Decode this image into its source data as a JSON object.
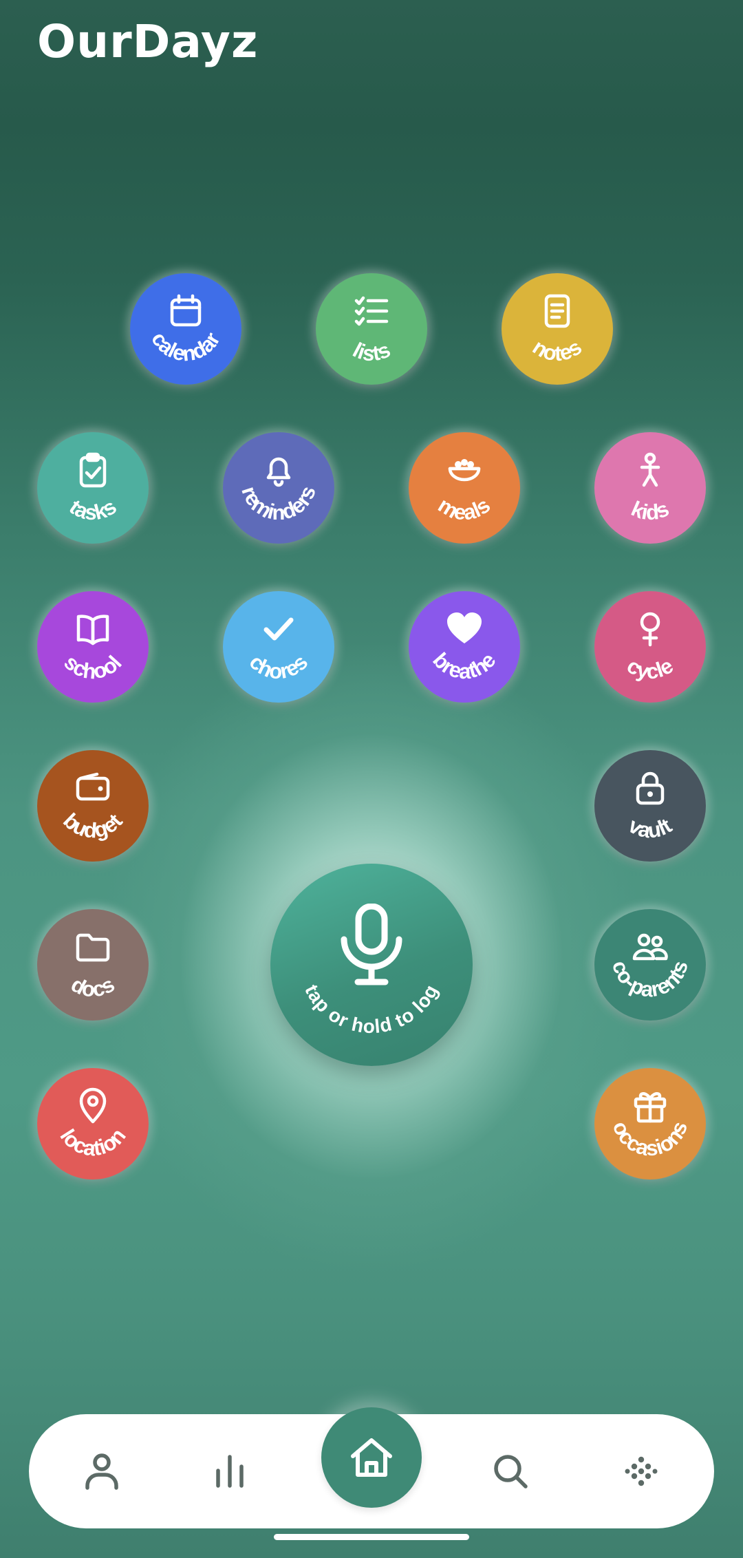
{
  "app": {
    "title": "OurDayz"
  },
  "modules": [
    {
      "id": "calendar",
      "label": "calendar",
      "color": "#3f6ee8",
      "icon": "calendar-icon"
    },
    {
      "id": "lists",
      "label": "lists",
      "color": "#5fb776",
      "icon": "checklist-icon"
    },
    {
      "id": "notes",
      "label": "notes",
      "color": "#dbb43a",
      "icon": "note-icon"
    },
    {
      "id": "tasks",
      "label": "tasks",
      "color": "#4eaf9f",
      "icon": "clipboard-check-icon"
    },
    {
      "id": "reminders",
      "label": "reminders",
      "color": "#5e6bb9",
      "icon": "bell-icon"
    },
    {
      "id": "meals",
      "label": "meals",
      "color": "#e58040",
      "icon": "bowl-icon"
    },
    {
      "id": "kids",
      "label": "kids",
      "color": "#de77ae",
      "icon": "child-icon"
    },
    {
      "id": "school",
      "label": "school",
      "color": "#a748dc",
      "icon": "book-icon"
    },
    {
      "id": "chores",
      "label": "chores",
      "color": "#58b4ea",
      "icon": "check-icon"
    },
    {
      "id": "breathe",
      "label": "breathe",
      "color": "#8a58eb",
      "icon": "heart-icon"
    },
    {
      "id": "cycle",
      "label": "cycle",
      "color": "#d55a86",
      "icon": "female-icon"
    },
    {
      "id": "budget",
      "label": "budget",
      "color": "#a6541f",
      "icon": "wallet-icon"
    },
    {
      "id": "vault",
      "label": "vault",
      "color": "#48555f",
      "icon": "lock-icon"
    },
    {
      "id": "docs",
      "label": "docs",
      "color": "#87706a",
      "icon": "folder-icon"
    },
    {
      "id": "co-parents",
      "label": "co-parents",
      "color": "#3c8675",
      "icon": "users-icon"
    },
    {
      "id": "location",
      "label": "location",
      "color": "#e15b58",
      "icon": "map-pin-icon"
    },
    {
      "id": "occasions",
      "label": "occasions",
      "color": "#db9040",
      "icon": "gift-icon"
    }
  ],
  "voice": {
    "label": "tap or hold to log",
    "icon": "microphone-icon"
  },
  "nav": {
    "items": [
      {
        "id": "profile",
        "icon": "user-icon"
      },
      {
        "id": "stats",
        "icon": "bar-chart-icon"
      },
      {
        "id": "home",
        "icon": "home-icon"
      },
      {
        "id": "search",
        "icon": "search-icon"
      },
      {
        "id": "more",
        "icon": "dots-grid-icon"
      }
    ],
    "accent": "#3f8a76",
    "icon_color": "#5c6a66"
  }
}
